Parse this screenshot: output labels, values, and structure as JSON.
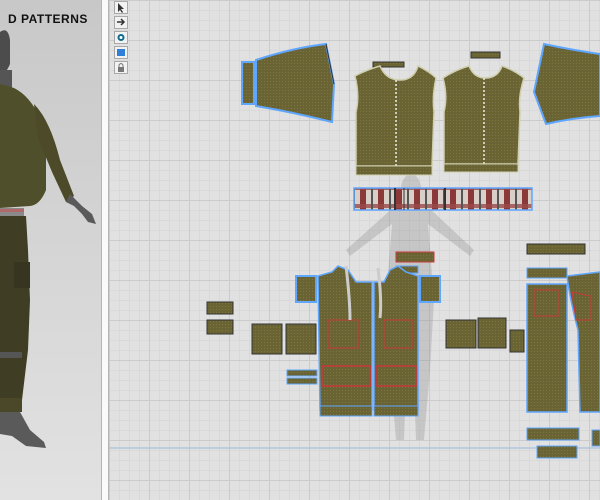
{
  "title": "D PATTERNS",
  "colors": {
    "fabric": "#6a6334",
    "seam_blue": "#5fa6ff",
    "stitch_red": "#c8383c",
    "grid": "#e1e1e1",
    "plaid_red": "#9b4b4b"
  },
  "toolbar": {
    "tools": [
      {
        "name": "select-tool",
        "icon": "pointer-icon"
      },
      {
        "name": "transform-tool",
        "icon": "transform-icon"
      },
      {
        "name": "camera-tool",
        "icon": "camera-icon"
      },
      {
        "name": "fabric-tool",
        "icon": "fabric-icon"
      },
      {
        "name": "lock-tool",
        "icon": "lock-icon"
      }
    ]
  }
}
